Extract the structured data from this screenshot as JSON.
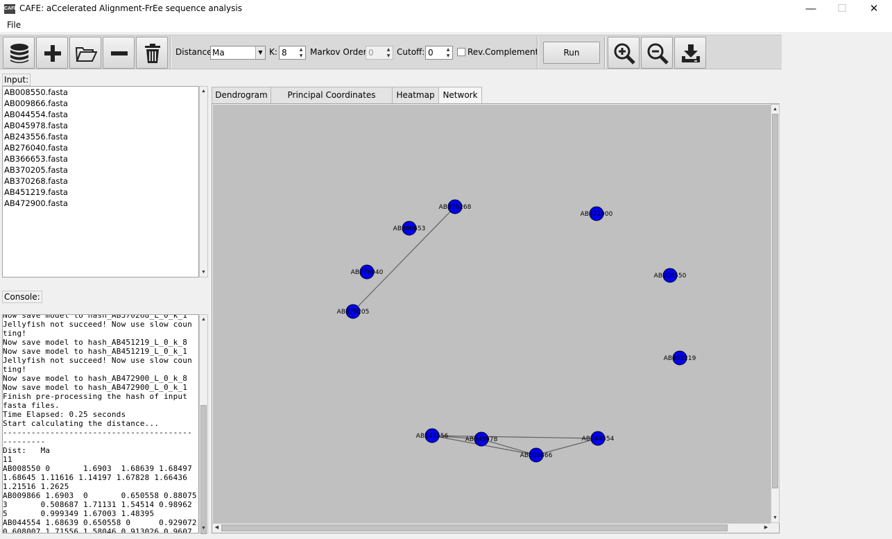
{
  "window": {
    "title": "CAFE: aCcelerated Alignment-FrEe sequence analysis",
    "icon_text": "CAFE",
    "minimize": "—",
    "maximize": "☐",
    "close": "✕"
  },
  "menu": {
    "file": "File"
  },
  "toolbar": {
    "buttons": [
      "database-icon",
      "plus-icon",
      "open-folder-icon",
      "minus-icon",
      "trash-icon",
      "zoom-in-icon",
      "zoom-out-icon",
      "download-icon"
    ],
    "distance_label": "Distance:",
    "distance_value": "Ma",
    "k_label": "K:",
    "k_value": "8",
    "markov_label": "Markov Order:",
    "markov_value": "0",
    "cutoff_label": "Cutoff:",
    "cutoff_value": "0",
    "revcomp_label": "Rev.Complement",
    "run_label": "Run"
  },
  "input": {
    "label": "Input:",
    "files": [
      "AB008550.fasta",
      "AB009866.fasta",
      "AB044554.fasta",
      "AB045978.fasta",
      "AB243556.fasta",
      "AB276040.fasta",
      "AB366653.fasta",
      "AB370205.fasta",
      "AB370268.fasta",
      "AB451219.fasta",
      "AB472900.fasta"
    ]
  },
  "console": {
    "label": "Console:",
    "text": "Now save model to hash_AB370268_L_0_k_1\nJellyfish not succeed! Now use slow coun\nting!\nNow save model to hash_AB451219_L_0_k_8\nNow save model to hash_AB451219_L_0_k_1\nJellyfish not succeed! Now use slow coun\nting!\nNow save model to hash_AB472900_L_0_k_8\nNow save model to hash_AB472900_L_0_k_1\nFinish pre-processing the hash of input\nfasta files.\nTime Elapsed: 0.25 seconds\nStart calculating the distance...\n----------------------------------------\n---------\nDist:   Ma\n11\nAB008550 0       1.6903  1.68639 1.68497\n1.68645 1.11616 1.14197 1.67828 1.66436\n1.21516 1.2625\nAB009866 1.6903  0       0.650558 0.88075\n3       0.508687 1.71131 1.54514 0.98962\n5       0.999349 1.67003 1.48395\nAB044554 1.68639 0.650558 0      0.929072\n0.608007 1.71556 1.58046 0.913026 0.9607"
  },
  "tabs": [
    "Dendrogram",
    "Principal Coordinates Analysis",
    "Heatmap",
    "Network"
  ],
  "active_tab": "Network",
  "network": {
    "node_color": "#0000ee",
    "edge_color": "#606060",
    "nodes": [
      {
        "id": "AB370268",
        "label": "AB370268"
      },
      {
        "id": "AB366653",
        "label": "AB366653"
      },
      {
        "id": "AB472900",
        "label": "AB472900"
      },
      {
        "id": "AB276040",
        "label": "AB276040"
      },
      {
        "id": "AB008550",
        "label": "AB008550"
      },
      {
        "id": "AB370205",
        "label": "AB370205"
      },
      {
        "id": "AB451219",
        "label": "AB451219"
      },
      {
        "id": "AB243556",
        "label": "AB243556"
      },
      {
        "id": "AB045978",
        "label": "AB045978"
      },
      {
        "id": "AB044554",
        "label": "AB044554"
      },
      {
        "id": "AB009866",
        "label": "AB009866"
      }
    ],
    "edges": [
      [
        "AB370268",
        "AB370205"
      ],
      [
        "AB243556",
        "AB045978"
      ],
      [
        "AB243556",
        "AB009866"
      ],
      [
        "AB243556",
        "AB044554"
      ],
      [
        "AB045978",
        "AB009866"
      ],
      [
        "AB009866",
        "AB044554"
      ]
    ]
  }
}
